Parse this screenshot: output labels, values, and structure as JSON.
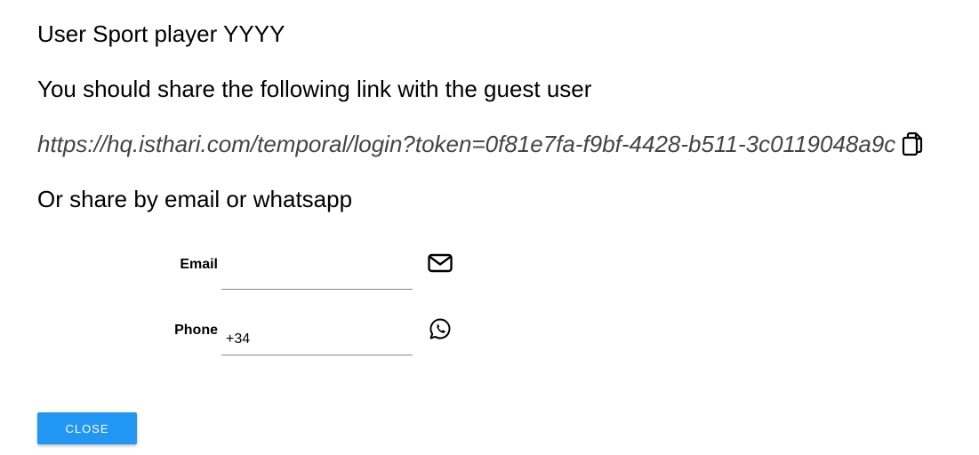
{
  "dialog": {
    "title": "User Sport player YYYY",
    "instruction": "You should share the following link with the guest user",
    "share_link": "https://hq.isthari.com/temporal/login?token=0f81e7fa-f9bf-4428-b511-3c0119048a9c",
    "copy_icon": "copy-icon",
    "alt_heading": "Or share by email or whatsapp"
  },
  "email": {
    "label": "Email",
    "value": "",
    "icon": "envelope-icon"
  },
  "phone": {
    "label": "Phone",
    "value": "+34",
    "icon": "whatsapp-icon"
  },
  "actions": {
    "close_label": "CLOSE"
  },
  "colors": {
    "close_button_bg": "#2196f3",
    "link_text": "#444444"
  }
}
